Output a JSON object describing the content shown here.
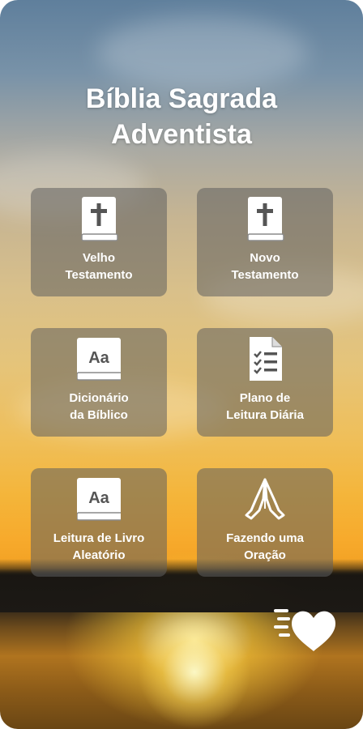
{
  "app": {
    "title_line1": "Bíblia Sagrada",
    "title_line2": "Adventista"
  },
  "menu": [
    {
      "line1": "Velho",
      "line2": "Testamento",
      "icon": "bible-cross-icon"
    },
    {
      "line1": "Novo",
      "line2": "Testamento",
      "icon": "bible-cross-icon"
    },
    {
      "line1": "Dicionário",
      "line2": "da Bíblico",
      "icon": "dictionary-book-icon",
      "icon_text": "Aa"
    },
    {
      "line1": "Plano de",
      "line2": "Leitura Diária",
      "icon": "checklist-document-icon"
    },
    {
      "line1": "Leitura de Livro",
      "line2": "Aleatório",
      "icon": "dictionary-book-icon",
      "icon_text": "Aa"
    },
    {
      "line1": "Fazendo uma",
      "line2": "Oração",
      "icon": "praying-hands-icon"
    }
  ],
  "favorite": {
    "icon": "fast-heart-icon"
  }
}
